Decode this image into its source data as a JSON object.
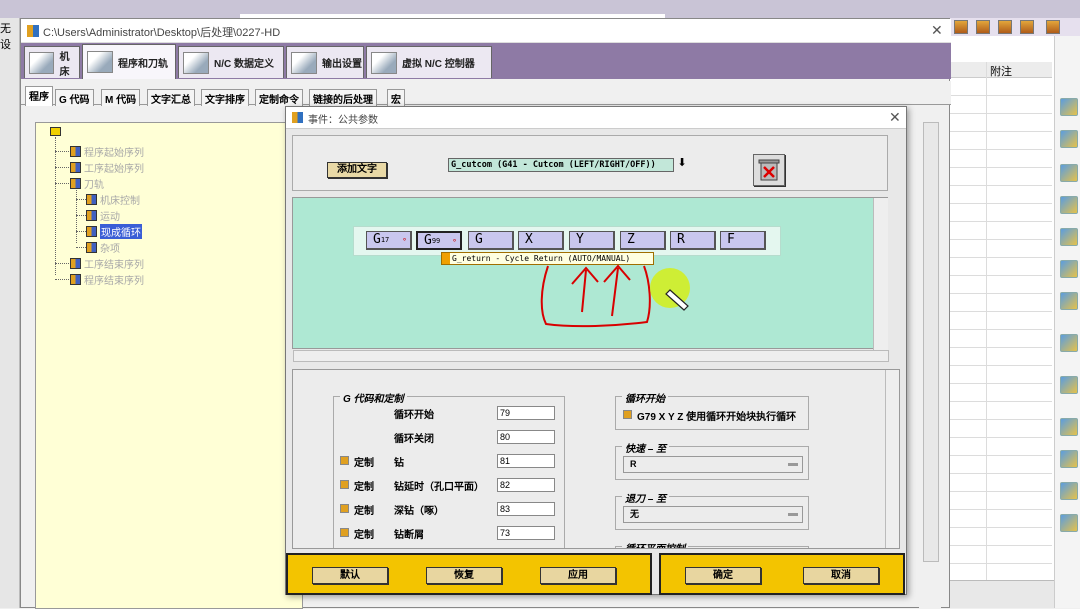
{
  "background": {
    "left_label": "无设",
    "right_column_header": "附注"
  },
  "main_window": {
    "title": "C:\\Users\\Administrator\\Desktop\\后处理\\0227-HD",
    "tabs": [
      "机床",
      "程序和刀轨",
      "N/C 数据定义",
      "输出设置",
      "虚拟 N/C 控制器"
    ],
    "subtabs": [
      "程序",
      "G 代码",
      "M 代码",
      "文字汇总",
      "文字排序",
      "定制命令",
      "链接的后处理",
      "宏"
    ]
  },
  "tree": {
    "nodes": [
      {
        "label": "程序起始序列",
        "dim": true
      },
      {
        "label": "工序起始序列",
        "dim": true
      },
      {
        "label": "刀轨",
        "dim": true
      },
      {
        "label": "机床控制",
        "dim": true
      },
      {
        "label": "运动",
        "dim": true
      },
      {
        "label": "现成循环",
        "dim": false,
        "selected": true
      },
      {
        "label": "杂项",
        "dim": true
      },
      {
        "label": "工序结束序列",
        "dim": true
      },
      {
        "label": "程序结束序列",
        "dim": true
      }
    ]
  },
  "dialog": {
    "title": "事件：公共参数",
    "add_text_button": "添加文字",
    "combo_value": "G_cutcom (G41 - Cutcom (LEFT/RIGHT/OFF))",
    "combo_arrow": "⬇",
    "word_tiles": [
      {
        "main": "G",
        "sup": "17",
        "dot": "°"
      },
      {
        "main": "G",
        "sup": "99",
        "dot": "°"
      },
      {
        "main": "G",
        "sup": "",
        "dot": ""
      },
      {
        "main": "X",
        "sup": "",
        "dot": ""
      },
      {
        "main": "Y",
        "sup": "",
        "dot": ""
      },
      {
        "main": "Z",
        "sup": "",
        "dot": ""
      },
      {
        "main": "R",
        "sup": "",
        "dot": ""
      },
      {
        "main": "F",
        "sup": "",
        "dot": ""
      }
    ],
    "tooltip": "G_return - Cycle Return (AUTO/MANUAL)",
    "gcode_group": {
      "title": "G 代码和定制",
      "rows": [
        {
          "custom": "",
          "label": "循环开始",
          "value": "79"
        },
        {
          "custom": "",
          "label": "循环关闭",
          "value": "80"
        },
        {
          "custom": "定制",
          "label": "钻",
          "value": "81"
        },
        {
          "custom": "定制",
          "label": "钻延时（孔口平面）",
          "value": "82"
        },
        {
          "custom": "定制",
          "label": "深钻（啄）",
          "value": "83"
        },
        {
          "custom": "定制",
          "label": "钻断屑",
          "value": "73"
        }
      ]
    },
    "cycle_start_group": {
      "title": "循环开始",
      "option": "G79 X Y Z  使用循环开始块执行循环"
    },
    "rapid_group": {
      "title": "快速 – 至",
      "value": "R"
    },
    "retract_group": {
      "title": "退刀 – 至",
      "value": "无"
    },
    "plane_group": {
      "title": "循环平面控制"
    },
    "buttons_left": [
      "默认",
      "恢复",
      "应用"
    ],
    "buttons_right": [
      "确定",
      "取消"
    ]
  },
  "colors": {
    "tab_band": "#8e7aa5",
    "tree_bg": "#ffffd6",
    "edit_area": "#aee8d3",
    "button_bar": "#f3c400",
    "annotation": "#d80000"
  }
}
